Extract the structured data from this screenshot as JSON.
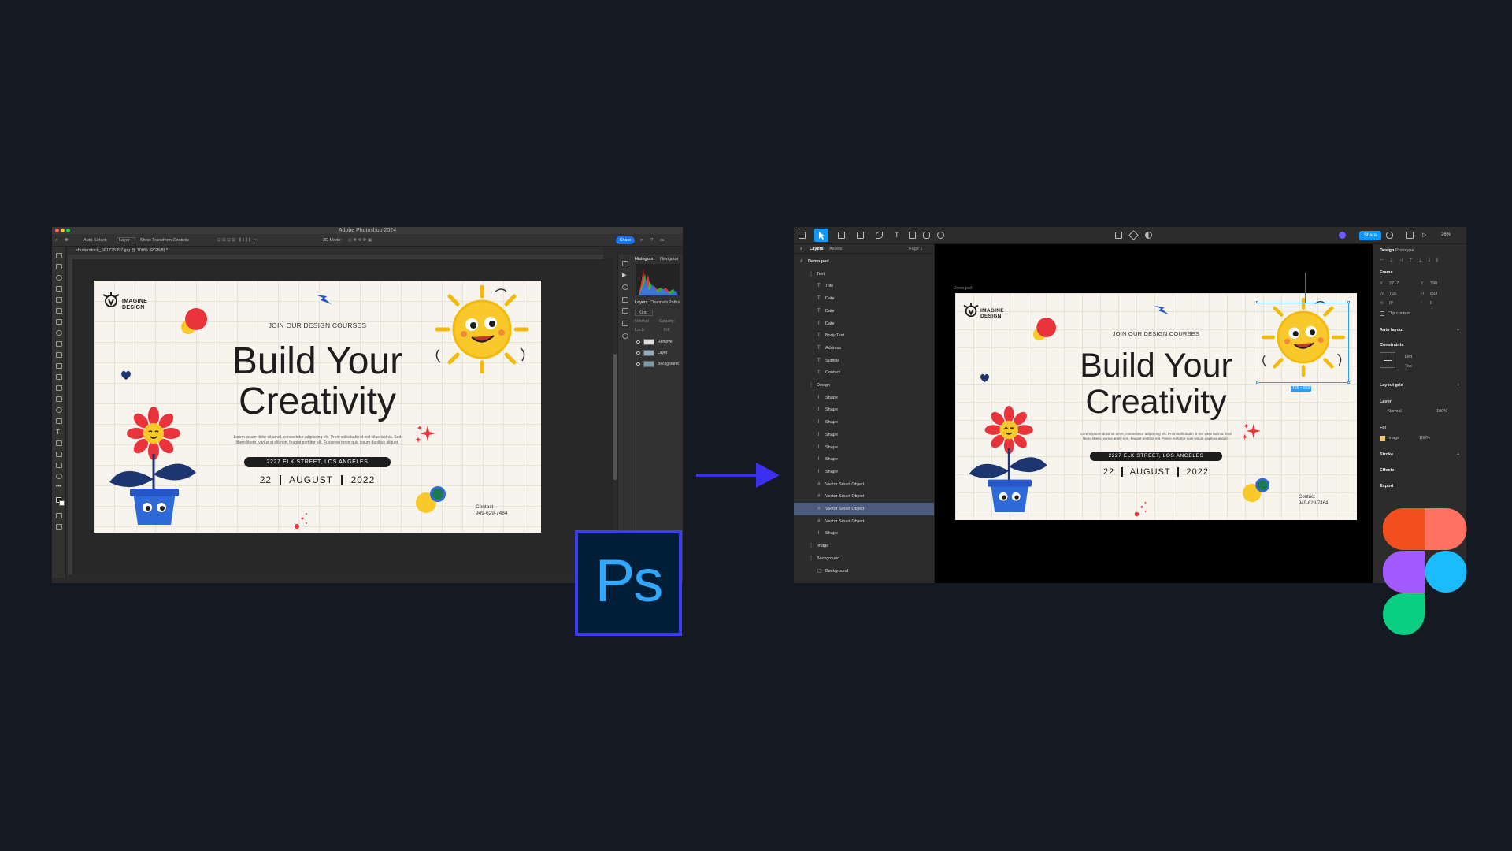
{
  "photoshop": {
    "window_title": "Adobe Photoshop 2024",
    "options": {
      "auto_select_label": "Auto-Select:",
      "layer_select_value": "Layer",
      "transform_controls_label": "Show Transform Controls",
      "mode_label": "3D Mode:",
      "share_label": "Share"
    },
    "document_tab": "shutterstock_661725397.jpg @ 100% (RGB/8) *",
    "panel": {
      "tabs_top": [
        "Histogram",
        "Navigator"
      ],
      "tabs_bottom": [
        "Layers",
        "Channels",
        "Paths"
      ],
      "kind_label": "Kind",
      "blend_label": "Normal",
      "opacity_label": "Opacity:",
      "lock_label": "Lock:",
      "fill_label": "Fill:",
      "layers": [
        "Remove",
        "Layer",
        "Background"
      ]
    }
  },
  "poster": {
    "logo_line1": "IMAGINE",
    "logo_line2": "DESIGN",
    "eyebrow": "JOIN OUR DESIGN COURSES",
    "title_line1": "Build Your",
    "title_line2": "Creativity",
    "body_line1": "Lorem ipsum dolor sit amet, consectetur adipiscing elit. Proin sollicitudin id nisl vitae lacinia. Sed",
    "body_line2": "libero libero, varius at elit non, feugiat porttitor elit. Fusce eu tortor quis ipsum dapibus aliquet.",
    "address": "2227 ELK STREET, LOS ANGELES",
    "date_day": "22",
    "date_month": "AUGUST",
    "date_year": "2022",
    "contact_label": "Contact",
    "contact_phone": "949-629-7464"
  },
  "figma": {
    "layers_tab": "Layers",
    "assets_tab": "Assets",
    "page_label": "Page 1",
    "share_label": "Share",
    "zoom_label": "26%",
    "frame_name": "Demo pad",
    "layer_tree": [
      {
        "label": "Demo pad",
        "depth": 0,
        "glyph": "#"
      },
      {
        "label": "Text",
        "depth": 1,
        "glyph": "⋮"
      },
      {
        "label": "Title",
        "depth": 2,
        "glyph": "T"
      },
      {
        "label": "Date",
        "depth": 2,
        "glyph": "T"
      },
      {
        "label": "Date",
        "depth": 2,
        "glyph": "T"
      },
      {
        "label": "Date",
        "depth": 2,
        "glyph": "T"
      },
      {
        "label": "Body Text",
        "depth": 2,
        "glyph": "T"
      },
      {
        "label": "Address",
        "depth": 2,
        "glyph": "T"
      },
      {
        "label": "Subtitle",
        "depth": 2,
        "glyph": "T"
      },
      {
        "label": "Contact",
        "depth": 2,
        "glyph": "T"
      },
      {
        "label": "Design",
        "depth": 1,
        "glyph": "⋮"
      },
      {
        "label": "Shape",
        "depth": 2,
        "glyph": "⌇"
      },
      {
        "label": "Shape",
        "depth": 2,
        "glyph": "⌇"
      },
      {
        "label": "Shape",
        "depth": 2,
        "glyph": "⌇"
      },
      {
        "label": "Shape",
        "depth": 2,
        "glyph": "⌇"
      },
      {
        "label": "Shape",
        "depth": 2,
        "glyph": "⌇"
      },
      {
        "label": "Shape",
        "depth": 2,
        "glyph": "⌇"
      },
      {
        "label": "Shape",
        "depth": 2,
        "glyph": "⌇"
      },
      {
        "label": "Vector Smart Object",
        "depth": 2,
        "glyph": "#"
      },
      {
        "label": "Vector Smart Object",
        "depth": 2,
        "glyph": "#"
      },
      {
        "label": "Vector Smart Object",
        "depth": 2,
        "glyph": "#",
        "selected": true
      },
      {
        "label": "Vector Smart Object",
        "depth": 2,
        "glyph": "#"
      },
      {
        "label": "Shape",
        "depth": 2,
        "glyph": "⌇"
      },
      {
        "label": "Image",
        "depth": 1,
        "glyph": "⋮"
      },
      {
        "label": "Background",
        "depth": 1,
        "glyph": "⋮"
      },
      {
        "label": "Background",
        "depth": 2,
        "glyph": "▢"
      }
    ],
    "canvas_frame_label": "Demo pad",
    "selection_size": "765 × 893",
    "right_panel": {
      "tab_design": "Design",
      "tab_prototype": "Prototype",
      "frame_label": "Frame",
      "x": "2717",
      "y": "390",
      "w": "765",
      "h": "893",
      "rotation": "0°",
      "radius": "0",
      "clip_content": "Clip content",
      "auto_layout": "Auto layout",
      "constraints": "Constraints",
      "constraint_h": "Left",
      "constraint_v": "Top",
      "layout_grid": "Layout grid",
      "layer_label": "Layer",
      "blend": "Normal",
      "layer_opacity": "100%",
      "fill_label": "Fill",
      "fill_type": "Image",
      "fill_opacity": "100%",
      "stroke_label": "Stroke",
      "effects_label": "Effects",
      "export_label": "Export"
    }
  },
  "colors": {
    "background": "#151922",
    "arrow": "#3b2ff0",
    "ps_logo_bg": "#001e36",
    "ps_logo_text": "#31a8ff",
    "ps_logo_border": "#3d3cf0",
    "figma_red": "#f24e1e",
    "figma_salmon": "#ff7262",
    "figma_purple": "#a259ff",
    "figma_blue": "#1abcfe",
    "figma_green": "#0acf83"
  }
}
